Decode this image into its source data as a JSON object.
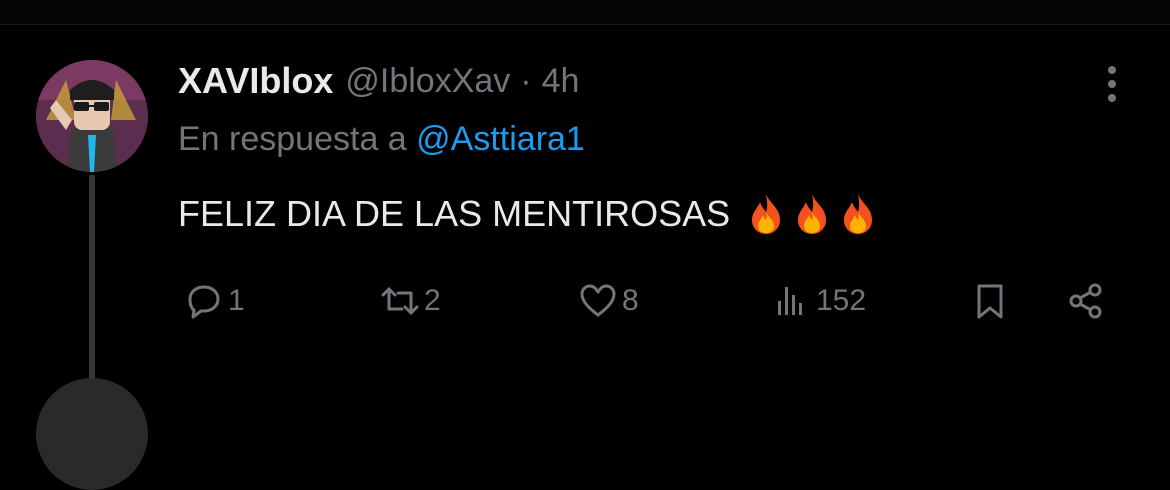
{
  "tweet": {
    "display_name": "XAVIblox",
    "handle": "@IbloxXav",
    "separator": "·",
    "time": "4h",
    "reply_prefix": "En respuesta a",
    "reply_to": "@Asttiara1",
    "text": "FELIZ DIA DE LAS MENTIROSAS",
    "emoji": [
      "fire-icon",
      "fire-icon",
      "fire-icon"
    ]
  },
  "actions": {
    "replies": "1",
    "retweets": "2",
    "likes": "8",
    "views": "152"
  },
  "colors": {
    "background": "#000000",
    "text": "#e7e9ea",
    "muted": "#71767b",
    "link": "#1d9bf0",
    "thread_line": "#333639"
  }
}
